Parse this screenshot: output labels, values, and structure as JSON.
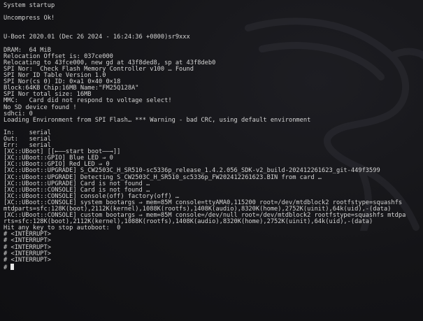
{
  "terminal": {
    "background_color": "#131316",
    "text_color": "#d4d4d4",
    "watermark_icon": "kali-dragon-icon",
    "lines": [
      "System startup",
      "",
      "Uncompress Ok!",
      "",
      "",
      "U-Boot 2020.01 (Dec 26 2024 - 16:24:36 +0800)sr9xxx",
      "",
      "DRAM:  64 MiB",
      "Relocation Offset is: 037ce000",
      "Relocating to 43fce000, new gd at 43f8ded8, sp at 43f8deb0",
      "SPI Nor:  Check Flash Memory Controller v100 … Found",
      "SPI Nor ID Table Version 1.0",
      "SPI Nor(cs 0) ID: 0×a1 0×40 0×18",
      "Block:64KB Chip:16MB Name:\"FM25Q128A\"",
      "SPI Nor total size: 16MB",
      "MMC:   Card did not respond to voltage select!",
      "No SD device found !",
      "sdhci: 0",
      "Loading Environment from SPI Flash… *** Warning - bad CRC, using default environment",
      "",
      "In:    serial",
      "Out:   serial",
      "Err:   serial",
      "[XC::UBoot] [[←——start boot——→]]",
      "[XC::UBoot::GPIO] Blue LED ⇒ 0",
      "[XC::UBoot::GPIO] Red LED ⇒ 0",
      "[XC::UBoot::UPGRADE] S_CW2503C_H_SR510-sc5336p_release_1.4.2.056_SDK-v2_build-202412261623_git-449f3599",
      "[XC::UBoot::UPGRADE] Detecting S_CW2503C_H_SR510_sc5336p_FW202412261623.BIN from card …",
      "[XC::UBoot::UPGRADE] Card is not found …",
      "[XC::UBoot::CONSOLE] Card is not found …",
      "[XC::UBoot::CONSOLE] console(off) factory(off) …",
      "[XC::UBoot::CONSOLE] system bootargs ⇒ mem=85M console=ttyAMA0,115200 root=/dev/mtdblock2 rootfstype=squashfs",
      "mtdparts=sfc:128K(boot),2112K(kernel),1088K(rootfs),1408K(audio),8320K(home),2752K(uinit),64k(uid),-(data)",
      "[XC::UBoot::CONSOLE] custom bootargs ⇒ mem=85M console=/dev/null root=/dev/mtdblock2 rootfstype=squashfs mtdpa",
      "rts=sfc:128K(boot),2112K(kernel),1088K(rootfs),1408K(audio),8320K(home),2752K(uinit),64k(uid),-(data)",
      "Hit any key to stop autoboot:  0",
      "# <INTERRUPT>",
      "# <INTERRUPT>",
      "# <INTERRUPT>",
      "# <INTERRUPT>",
      "# <INTERRUPT>"
    ],
    "prompt": "#"
  }
}
